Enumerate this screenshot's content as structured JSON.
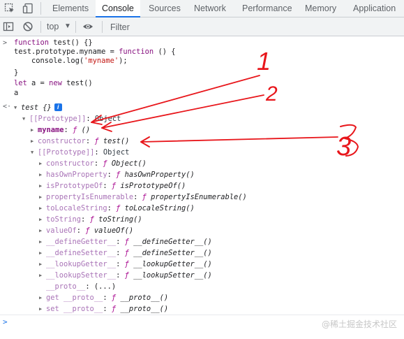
{
  "tabs": [
    "Elements",
    "Console",
    "Sources",
    "Network",
    "Performance",
    "Memory",
    "Application"
  ],
  "active_tab": "Console",
  "toolbar": {
    "context": "top",
    "filter_placeholder": "Filter"
  },
  "code": {
    "l1_a": "function",
    "l1_b": " test() {}",
    "l2_a": "test.prototype.myname = ",
    "l2_b": "function",
    "l2_c": " () {",
    "l3_a": "    console.log(",
    "l3_b": "'myname'",
    "l3_c": ");",
    "l4": "}",
    "l5_a": "let",
    "l5_b": " a = ",
    "l5_c": "new",
    "l5_d": " test()",
    "l6": "a"
  },
  "output": {
    "root": "test {}",
    "badge": "i",
    "proto1_key": "[[Prototype]]",
    "proto1_val": "Object",
    "myname_key": "myname",
    "myname_val": "() ",
    "ctor_key": "constructor",
    "ctor_val": "test()",
    "proto2_key": "[[Prototype]]",
    "proto2_val": "Object",
    "members": [
      {
        "key": "constructor",
        "val": "Object()"
      },
      {
        "key": "hasOwnProperty",
        "val": "hasOwnProperty()"
      },
      {
        "key": "isPrototypeOf",
        "val": "isPrototypeOf()"
      },
      {
        "key": "propertyIsEnumerable",
        "val": "propertyIsEnumerable()"
      },
      {
        "key": "toLocaleString",
        "val": "toLocaleString()"
      },
      {
        "key": "toString",
        "val": "toString()"
      },
      {
        "key": "valueOf",
        "val": "valueOf()"
      },
      {
        "key": "__defineGetter__",
        "val": "__defineGetter__()"
      },
      {
        "key": "__defineSetter__",
        "val": "__defineSetter__()"
      },
      {
        "key": "__lookupGetter__",
        "val": "__lookupGetter__()"
      },
      {
        "key": "__lookupSetter__",
        "val": "__lookupSetter__()"
      }
    ],
    "proto_accessor": "__proto__",
    "proto_accessor_val": "(...)",
    "getter_key": "get __proto__",
    "getter_val": "__proto__()",
    "setter_key": "set __proto__",
    "setter_val": "__proto__()",
    "fn_symbol": "ƒ"
  },
  "annotations": [
    "1",
    "2",
    "3"
  ],
  "annotation_color": "#e8161b",
  "watermark": "@稀土掘金技术社区"
}
